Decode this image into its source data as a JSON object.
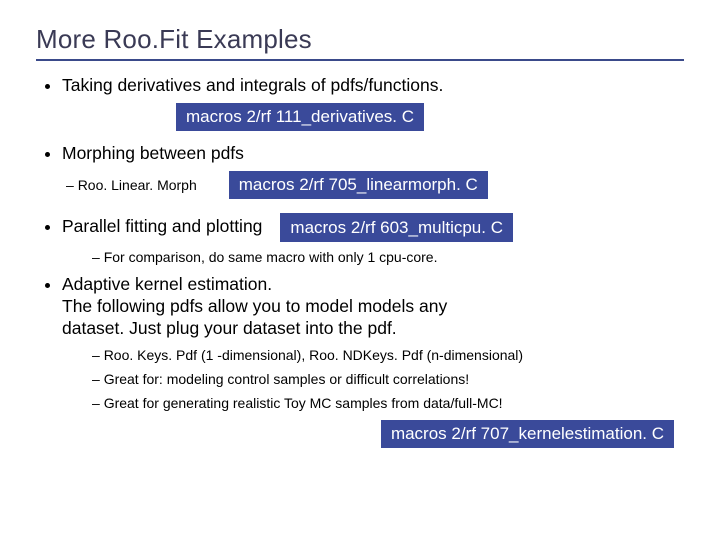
{
  "title": "More Roo.Fit Examples",
  "bullets": {
    "b1": "Taking derivatives and integrals of pdfs/functions.",
    "b1_tag": "macros 2/rf 111_derivatives. C",
    "b2": "Morphing between pdfs",
    "b2_sub1": "Roo. Linear. Morph",
    "b2_tag": "macros 2/rf 705_linearmorph. C",
    "b3": "Parallel fitting and plotting",
    "b3_tag": "macros 2/rf 603_multicpu. C",
    "b3_sub1": "For comparison, do same macro with only 1 cpu-core.",
    "b4_line1": "Adaptive kernel estimation.",
    "b4_line2": "The following pdfs allow you to model models any",
    "b4_line3": "dataset. Just plug your dataset into the pdf.",
    "b4_sub1": "Roo. Keys. Pdf (1 -dimensional), Roo. NDKeys. Pdf (n-dimensional)",
    "b4_sub2": "Great for: modeling control samples or difficult correlations!",
    "b4_sub3": "Great for generating realistic Toy MC samples from data/full-MC!",
    "b4_tag": "macros 2/rf 707_kernelestimation. C"
  }
}
